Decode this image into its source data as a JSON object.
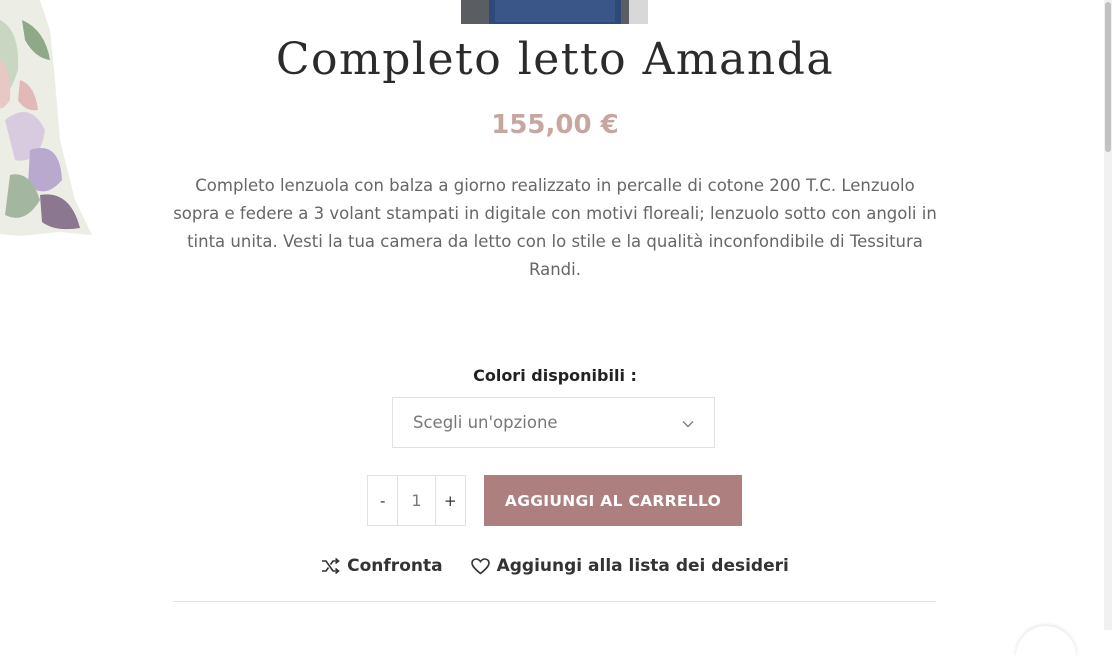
{
  "product": {
    "title": "Completo letto Amanda",
    "price": "155,00 €",
    "description": "Completo lenzuola con balza a giorno realizzato in percalle di cotone 200 T.C. Lenzuolo sopra e federe a 3 volant stampati in digitale con motivi floreali; lenzuolo sotto con angoli in tinta unita. Vesti la tua camera da letto con lo stile e la qualità inconfondibile di Tessitura Randi."
  },
  "variations": {
    "label": "Colori disponibili",
    "select_value": "Scegli un'opzione"
  },
  "cart": {
    "minus": "-",
    "quantity": "1",
    "plus": "+",
    "add_label": "AGGIUNGI AL CARRELLO"
  },
  "actions": {
    "compare_label": "Confronta",
    "wishlist_label": "Aggiungi alla lista dei desideri"
  },
  "colors": {
    "accent": "#ad7f7f",
    "price": "#c7a6a0"
  },
  "icons": {
    "compare": "shuffle-icon",
    "wishlist": "heart-icon",
    "select": "chevron-down-icon"
  }
}
